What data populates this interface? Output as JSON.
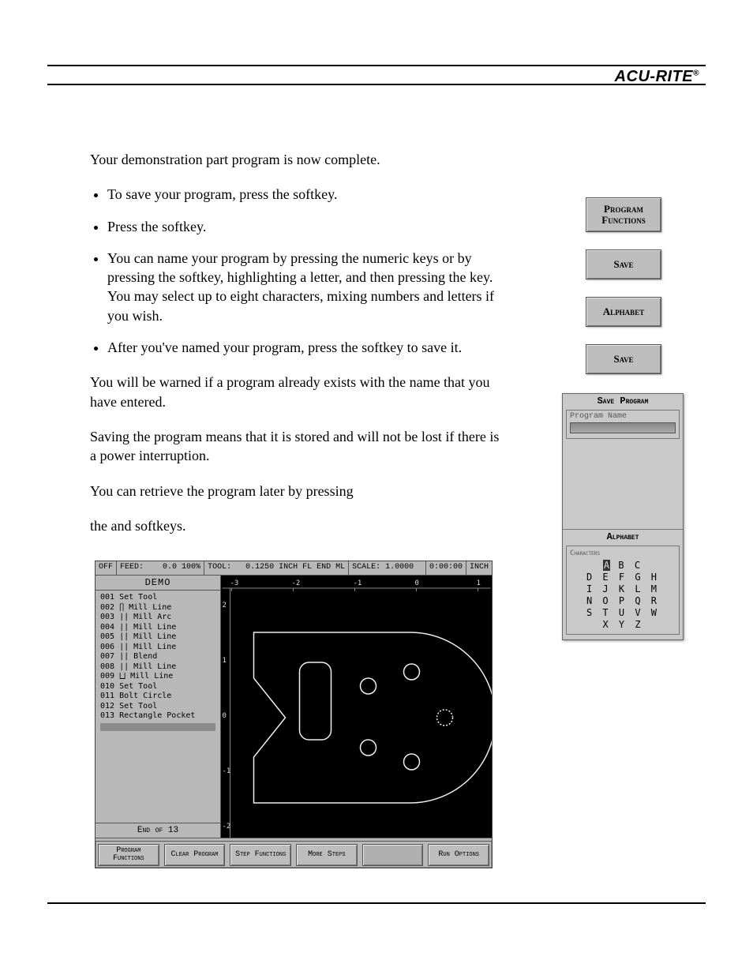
{
  "brand": "ACU-RITE",
  "brand_mark": "®",
  "intro": "Your demonstration part program is now complete.",
  "bullets": [
    "To save your program, press the                                          softkey.",
    "Press the             softkey.",
    "You can name your program by pressing the numeric keys or by pressing the                      softkey, highlighting a letter, and then pressing the               key. You may select up to eight characters, mixing numbers and letters if you wish.",
    "After you've named your program, press the              softkey to save it."
  ],
  "warn_para": "You will be warned if a program already exists with the name that you have entered.",
  "save_para": "Saving the program means that it is stored and will not be lost if there is a power interruption.",
  "retrieve_line1": "You can retrieve the program later by pressing",
  "retrieve_line2": "the                                       and              softkeys.",
  "right_softkeys": [
    "Program Functions",
    "Save",
    "Alphabet",
    "Save"
  ],
  "save_panel": {
    "title": "Save Program",
    "box_label": "Program Name",
    "alpha_label": "Alphabet",
    "chars_title": "Characters",
    "chars_rows": [
      "A B C",
      "D E F G H",
      "I J K L M",
      "N O P Q R",
      "S T U V W",
      "X Y Z"
    ],
    "selected": "A"
  },
  "demo": {
    "status": {
      "off": "OFF",
      "feed_label": "FEED:",
      "feed_val": "0.0 100%",
      "tool_label": "TOOL:",
      "tool_val": "0.1250 INCH FL END ML",
      "scale_label": "SCALE: 1.0000",
      "time": "0:00:00",
      "units": "INCH"
    },
    "title": "DEMO",
    "steps": [
      "001    Set Tool",
      "002 ∏ Mill Line",
      "003 || Mill Arc",
      "004 || Mill Line",
      "005 || Mill Line",
      "006 || Mill Line",
      "007 || Blend",
      "008 || Mill Line",
      "009 ⨆ Mill Line",
      "010    Set Tool",
      "011    Bolt Circle",
      "012    Set Tool",
      "013    Rectangle Pocket"
    ],
    "end": "End of 13",
    "softkeys": [
      "Program Functions",
      "Clear Program",
      "Step Functions",
      "More Steps",
      "",
      "Run Options"
    ],
    "ruler_x": [
      "-3",
      "-2",
      "-1",
      "0",
      "1"
    ],
    "ruler_y": [
      "2",
      "1",
      "0",
      "-1",
      "-2"
    ]
  }
}
